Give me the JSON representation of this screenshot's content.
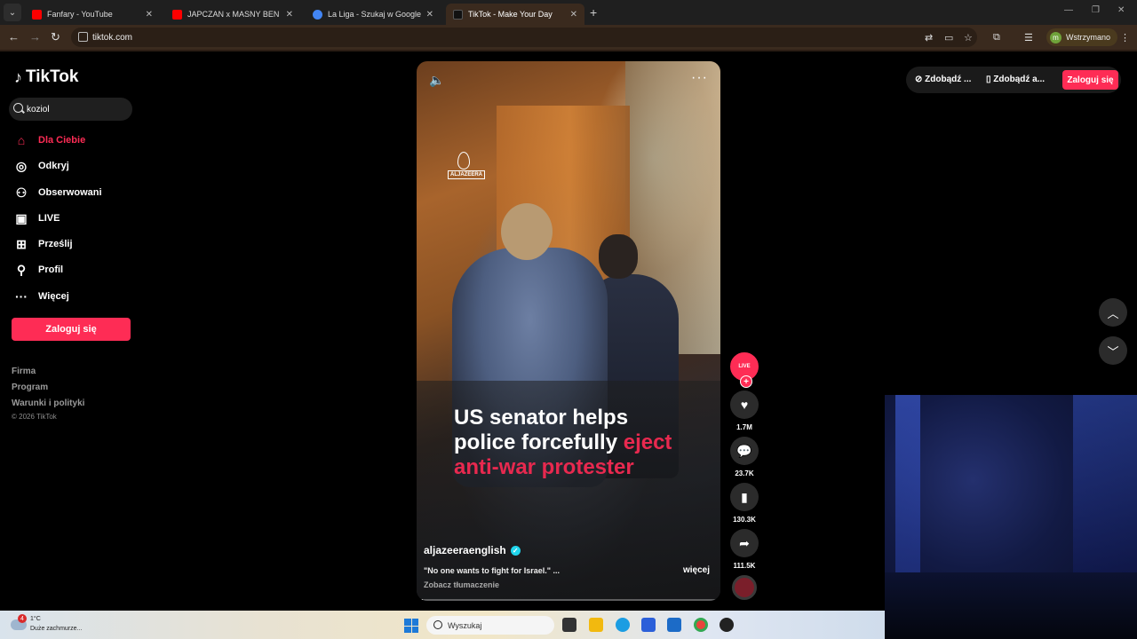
{
  "browser": {
    "tabs": [
      {
        "title": "Fanfary - YouTube",
        "color": "#ff0000"
      },
      {
        "title": "JAPCZAN x MASNY BEN - SHA",
        "color": "#ff0000"
      },
      {
        "title": "La Liga - Szukaj w Google",
        "color": "#4285f4"
      },
      {
        "title": "TikTok - Make Your Day",
        "color": "#111111"
      }
    ],
    "url": "tiktok.com",
    "profile_initial": "m",
    "profile_label": "Wstrzymano"
  },
  "sidebar": {
    "logo": "TikTok",
    "search_value": "koziol",
    "items": [
      {
        "label": "Dla Ciebie",
        "icon": "home-icon"
      },
      {
        "label": "Odkryj",
        "icon": "compass-icon"
      },
      {
        "label": "Obserwowani",
        "icon": "following-icon"
      },
      {
        "label": "LIVE",
        "icon": "live-icon"
      },
      {
        "label": "Prześlij",
        "icon": "upload-icon"
      },
      {
        "label": "Profil",
        "icon": "profile-icon"
      },
      {
        "label": "Więcej",
        "icon": "more-icon"
      }
    ],
    "login_label": "Zaloguj się",
    "footer": [
      "Firma",
      "Program",
      "Warunki i polityki"
    ],
    "copyright": "© 2026 TikTok"
  },
  "video": {
    "brand": "ALJAZEERA",
    "headline_white": "US senator helps police forcefully",
    "headline_red": "eject anti-war protester",
    "author": "aljazeeraenglish",
    "caption": "\"No one wants to fight for Israel.\" ...",
    "more_label": "więcej",
    "translate_label": "Zobacz tłumaczenie",
    "progress": 0.02
  },
  "actions": {
    "live_label": "LIVE",
    "likes": "1.7M",
    "comments": "23.7K",
    "saves": "130.3K",
    "shares": "111.5K"
  },
  "top_right": {
    "coins_label": "Zdobądź ...",
    "app_label": "Zdobądź a...",
    "login_label": "Zaloguj się"
  },
  "taskbar": {
    "notification_count": "4",
    "temperature": "1°C",
    "weather_desc": "Duże zachmurze...",
    "search_placeholder": "Wyszukaj"
  },
  "colors": {
    "accent": "#fe2c55",
    "headline_red": "#e8294f"
  }
}
